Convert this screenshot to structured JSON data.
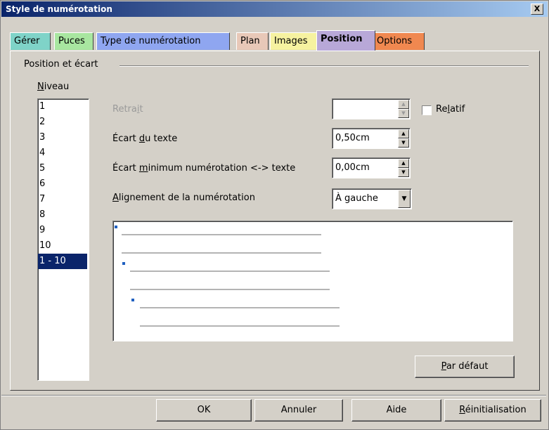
{
  "window": {
    "title": "Style de numérotation",
    "close_label": "X"
  },
  "tabs": [
    {
      "label": "Gérer",
      "color": "#7fd3c8"
    },
    {
      "label": "Puces",
      "color": "#a8e6a0"
    },
    {
      "label": "Type de numérotation",
      "color": "#8fa6f0"
    },
    {
      "label": "Plan",
      "color": "#e8c8b8"
    },
    {
      "label": "Images",
      "color": "#f6f2a0"
    },
    {
      "label": "Position",
      "color": "#b8a8d8"
    },
    {
      "label": "Options",
      "color": "#f08850"
    }
  ],
  "active_tab": "Position",
  "group": {
    "label": "Position et écart"
  },
  "level": {
    "label_pre": "",
    "label_key": "N",
    "label_post": "iveau",
    "items": [
      "1",
      "2",
      "3",
      "4",
      "5",
      "6",
      "7",
      "8",
      "9",
      "10",
      "1 - 10"
    ],
    "selected": "1 - 10"
  },
  "fields": {
    "retrait": {
      "label_pre": "Retra",
      "label_key": "i",
      "label_post": "t",
      "value": ""
    },
    "relatif": {
      "label_pre": "Re",
      "label_key": "l",
      "label_post": "atif",
      "checked": false
    },
    "ecart_texte": {
      "label_pre": "Écart ",
      "label_key": "d",
      "label_post": "u texte",
      "value": "0,50cm"
    },
    "ecart_min": {
      "label_pre": "Écart ",
      "label_key": "m",
      "label_post": "inimum numérotation <-> texte",
      "value": "0,00cm"
    },
    "alignement": {
      "label_pre": "",
      "label_key": "A",
      "label_post": "lignement de la numérotation",
      "value": "À gauche"
    }
  },
  "buttons": {
    "par_defaut": {
      "label_pre": "",
      "label_key": "P",
      "label_post": "ar défaut"
    },
    "ok": "OK",
    "annuler": "Annuler",
    "aide": "Aide",
    "reinit": {
      "label_pre": "",
      "label_key": "R",
      "label_post": "éinitialisation"
    }
  },
  "icons": {
    "spin_up": "▲",
    "spin_down": "▼",
    "dropdown": "▼"
  }
}
